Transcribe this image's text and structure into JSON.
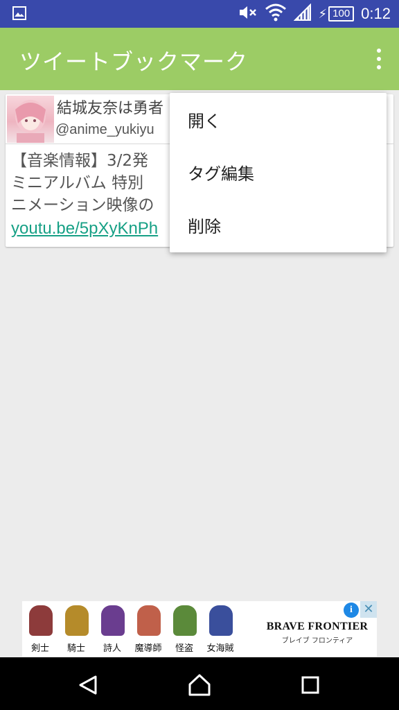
{
  "status_bar": {
    "time": "0:12",
    "battery_level": "100",
    "icons": [
      "image-notification-icon",
      "mute-icon",
      "wifi-icon",
      "signal-icon",
      "charging-icon",
      "battery-icon"
    ]
  },
  "app_bar": {
    "title": "ツイートブックマーク",
    "menu_icon": "overflow-menu-icon",
    "color": "#9ccc65"
  },
  "tweet": {
    "name": "結城友奈は勇者",
    "handle": "@anime_yukiyu",
    "body_lines": [
      "【音楽情報】3/2発",
      "ミニアルバム 特別",
      "ニメーション映像の"
    ],
    "link": "youtu.be/5pXyKnPh"
  },
  "menu": {
    "items": [
      {
        "label": "開く"
      },
      {
        "label": "タグ編集"
      },
      {
        "label": "削除"
      }
    ]
  },
  "ad": {
    "characters": [
      {
        "label": "剣士",
        "color": "#8d3b3b"
      },
      {
        "label": "騎士",
        "color": "#b58b2a"
      },
      {
        "label": "詩人",
        "color": "#6a3d8f"
      },
      {
        "label": "魔導師",
        "color": "#c0604a"
      },
      {
        "label": "怪盗",
        "color": "#5b8a3a"
      },
      {
        "label": "女海賊",
        "color": "#3a4f9c"
      }
    ],
    "logo_title": "BRAVE FRONTIER",
    "logo_subtitle": "ブレイブ フロンティア",
    "info_label": "i",
    "close_label": "✕"
  },
  "nav_bar": {
    "buttons": [
      "back-icon",
      "home-icon",
      "recents-icon"
    ]
  }
}
